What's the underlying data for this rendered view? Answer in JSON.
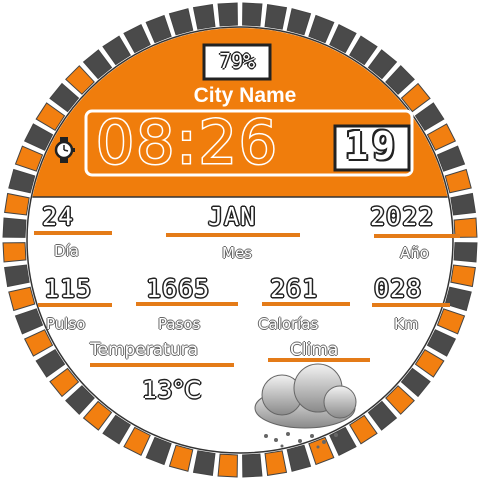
{
  "header": {
    "battery": "79%",
    "city": "City Name",
    "time_hm": "08:26",
    "time_s": "19",
    "watch_icon": "watch-icon"
  },
  "date": {
    "day_value": "24",
    "day_label": "Día",
    "month_value": "JAN",
    "month_label": "Mes",
    "year_value": "2022",
    "year_label": "Año"
  },
  "stats": {
    "pulse_value": "115",
    "pulse_label": "Pulso",
    "steps_value": "1665",
    "steps_label": "Pasos",
    "calories_value": "261",
    "calories_label": "Calorías",
    "km_value": "028",
    "km_label": "Km"
  },
  "weather": {
    "temp_label": "Temperatura",
    "climate_label": "Clima",
    "temp_value": "13°C",
    "icon": "cloud-snow-icon"
  },
  "colors": {
    "accent": "#f07d0c",
    "ring_dark": "#4a4a4a",
    "ring_orange": "#f27f10"
  }
}
